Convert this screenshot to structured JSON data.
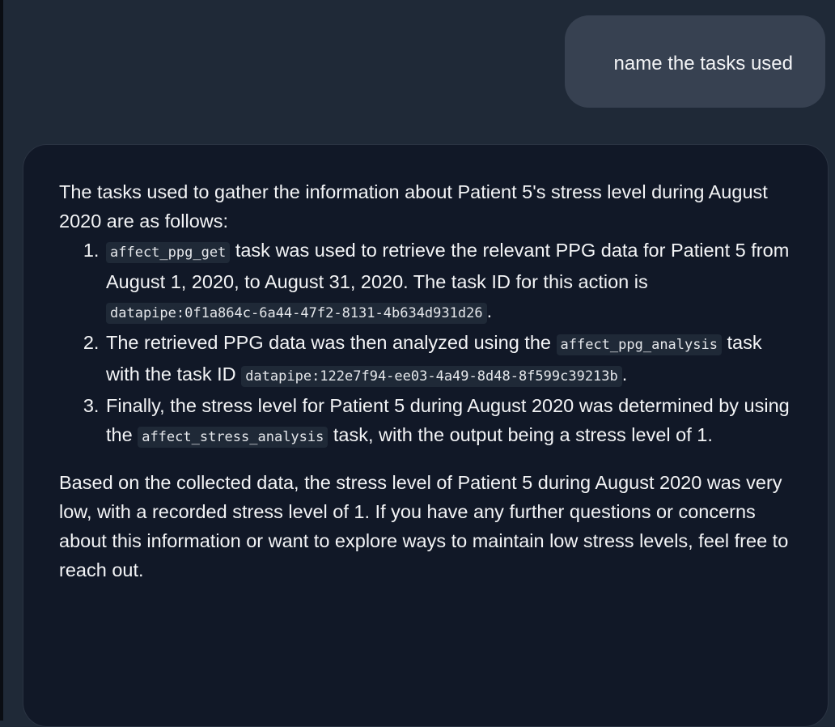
{
  "user_message": "name the tasks used",
  "assistant": {
    "intro": "The tasks used to gather the information about Patient 5's stress level during August 2020 are as follows:",
    "steps": [
      {
        "code1": "affect_ppg_get",
        "text1": " task was used to retrieve the relevant PPG data for Patient 5 from August 1, 2020, to August 31, 2020. The task ID for this action is ",
        "code2": "datapipe:0f1a864c-6a44-47f2-8131-4b634d931d26",
        "text2": "."
      },
      {
        "text0": "The retrieved PPG data was then analyzed using the ",
        "code1": "affect_ppg_analysis",
        "text1": " task with the task ID ",
        "code2": "datapipe:122e7f94-ee03-4a49-8d48-8f599c39213b",
        "text2": "."
      },
      {
        "text0": "Finally, the stress level for Patient 5 during August 2020 was determined by using the ",
        "code1": "affect_stress_analysis",
        "text1": " task, with the output being a stress level of 1."
      }
    ],
    "closing": "Based on the collected data, the stress level of Patient 5 during August 2020 was very low, with a recorded stress level of 1. If you have any further questions or concerns about this information or want to explore ways to maintain low stress levels, feel free to reach out."
  }
}
